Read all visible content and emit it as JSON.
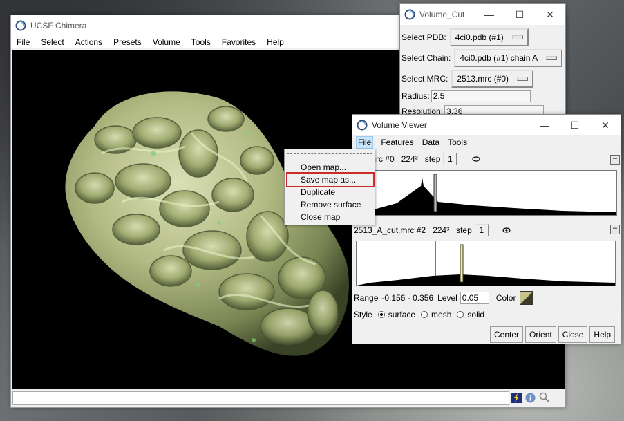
{
  "chimera": {
    "title": "UCSF Chimera",
    "menus": [
      "File",
      "Select",
      "Actions",
      "Presets",
      "Volume",
      "Tools",
      "Favorites",
      "Help"
    ],
    "status_text": ""
  },
  "volume_cut": {
    "title": "Volume_Cut",
    "pdb_label": "Select PDB:",
    "pdb_value": "4ci0.pdb (#1)",
    "chain_label": "Select Chain:",
    "chain_value": "4ci0.pdb (#1) chain A",
    "mrc_label": "Select MRC:",
    "mrc_value": "2513.mrc (#0)",
    "radius_label": "Radius:",
    "radius_value": "2.5",
    "resolution_label": "Resolution:",
    "resolution_value": "3.36"
  },
  "volume_viewer": {
    "title": "Volume Viewer",
    "menus": [
      "File",
      "Features",
      "Data",
      "Tools"
    ],
    "map1": {
      "name": "mrc #0",
      "size": "224³",
      "step_label": "step",
      "step_value": "1"
    },
    "map2": {
      "name": "2513_A_cut.mrc #2",
      "size": "224³",
      "step_label": "step",
      "step_value": "1"
    },
    "range_label": "Range",
    "range_value": "-0.156 - 0.356",
    "level_label": "Level",
    "level_value": "0.05",
    "color_label": "Color",
    "swatch_color": "#c7c18b",
    "style_label": "Style",
    "style_options": [
      "surface",
      "mesh",
      "solid"
    ],
    "style_selected": "surface",
    "buttons": [
      "Center",
      "Orient",
      "Close",
      "Help"
    ]
  },
  "file_menu": {
    "items": [
      "Open map...",
      "Save map as...",
      "Duplicate",
      "Remove surface",
      "Close map"
    ],
    "highlighted": "Save map as..."
  }
}
